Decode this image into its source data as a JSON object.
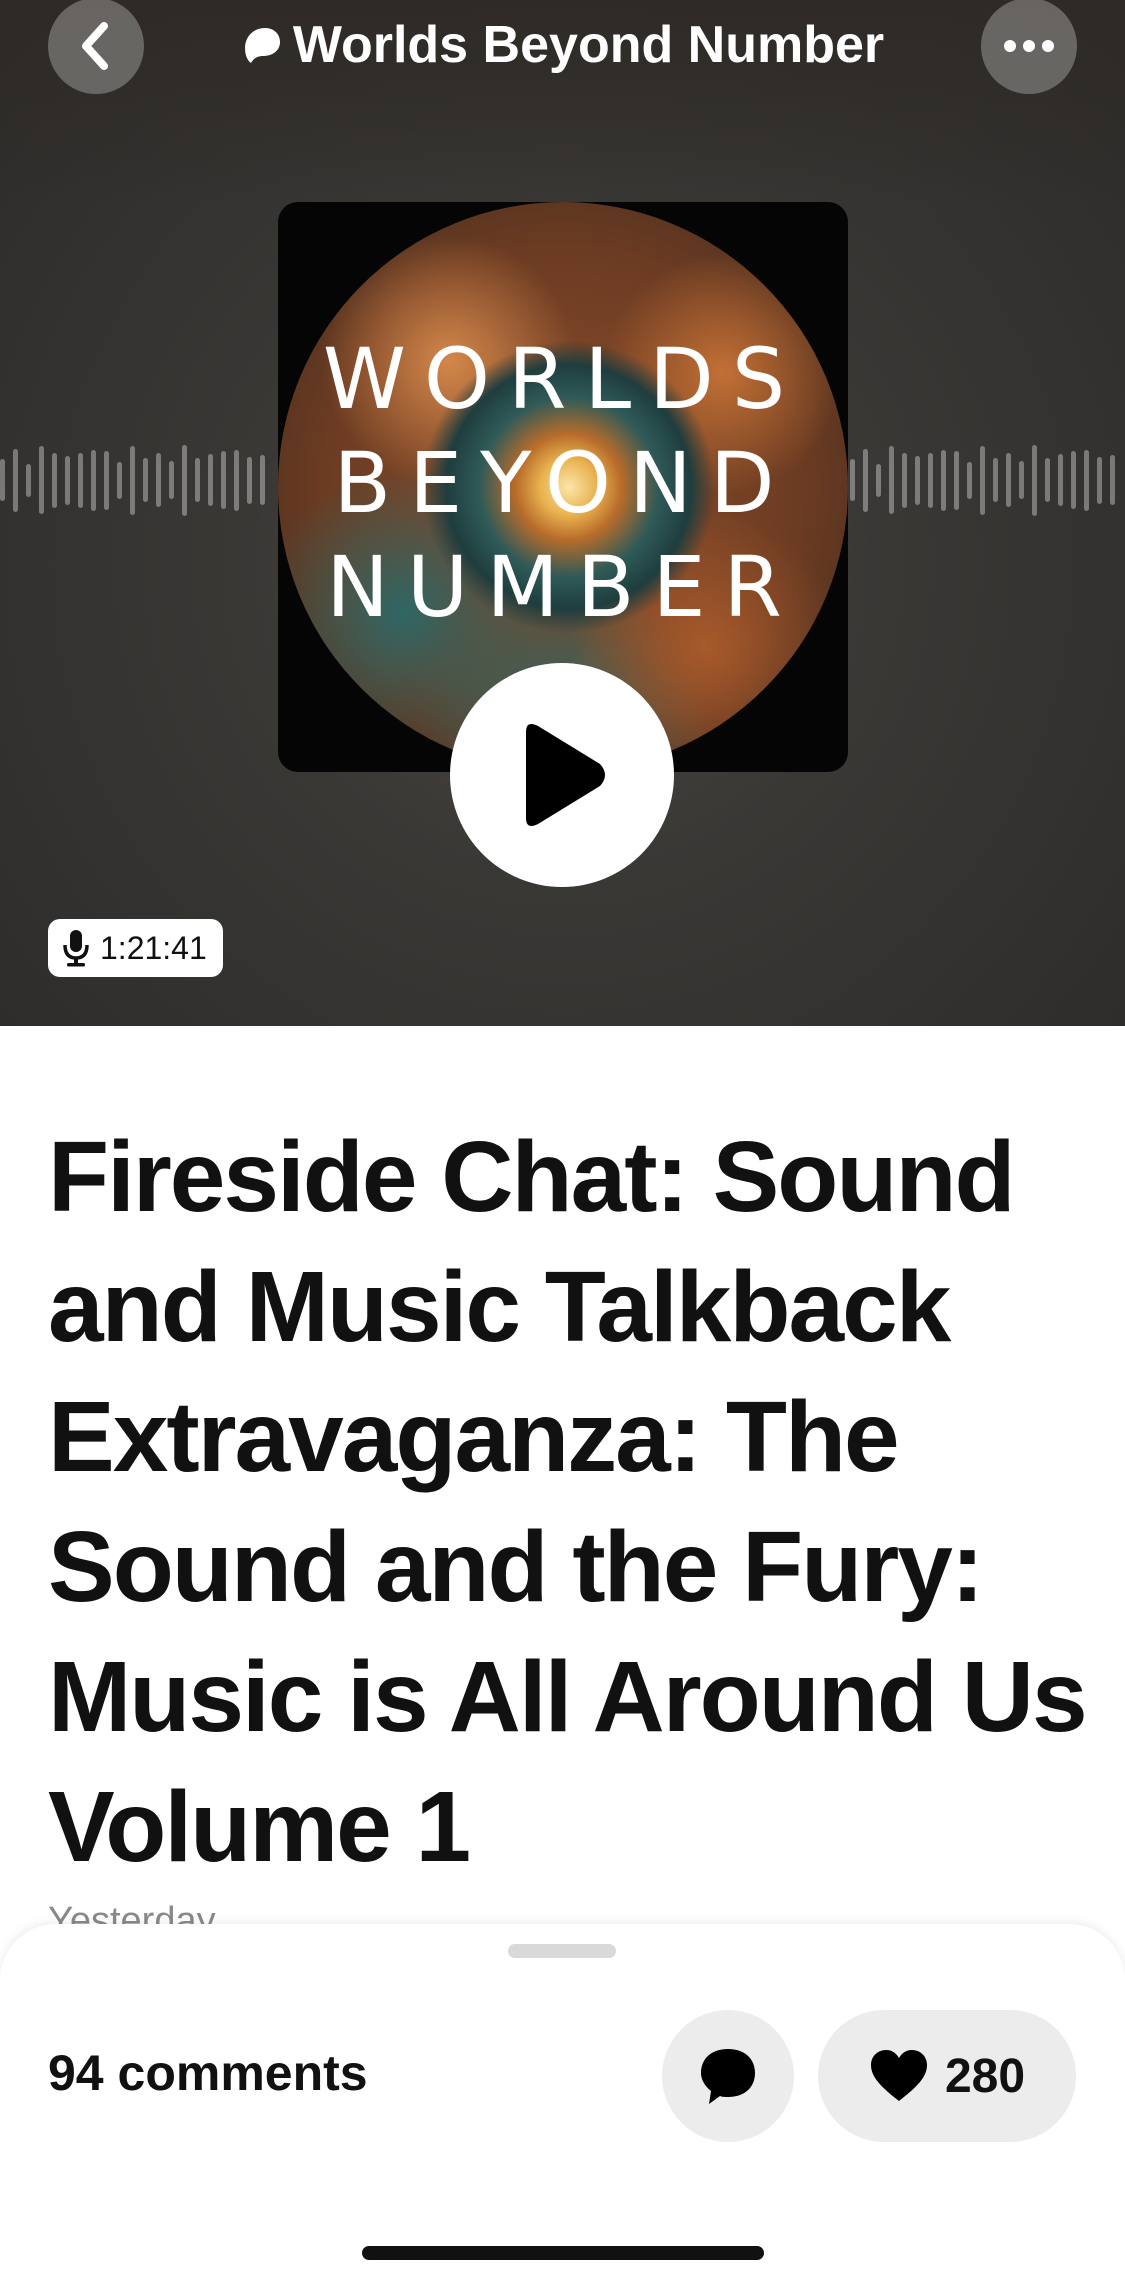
{
  "header": {
    "title": "Worlds Beyond Number",
    "back_icon": "chevron-left-icon",
    "brand_icon": "patreon-icon",
    "more_icon": "ellipsis-icon"
  },
  "artwork": {
    "lines": [
      "WORLDS",
      "BEYOND",
      "NUMBER"
    ],
    "play_icon": "play-icon"
  },
  "player": {
    "duration": "1:21:41",
    "duration_icon": "microphone-icon"
  },
  "episode": {
    "title": "Fireside Chat: Sound and Music Talkback Extravaganza: The Sound and the Fury: Music is All Around Us Volume 1",
    "date": "Yesterday"
  },
  "sheet": {
    "comments_label": "94 comments",
    "comment_icon": "speech-bubble-icon",
    "like_icon": "heart-icon",
    "likes": "280"
  },
  "colors": {
    "hero_bg": "#3a3835",
    "button_bg": "#ececec",
    "text": "#111111",
    "muted": "#8a8a8a"
  }
}
